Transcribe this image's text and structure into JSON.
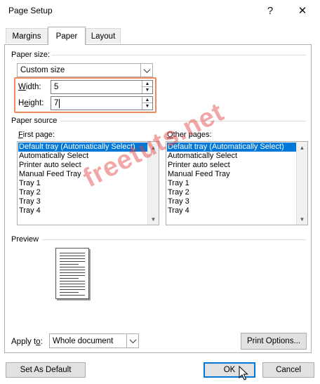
{
  "window": {
    "title": "Page Setup",
    "help_label": "?",
    "close_label": "✕"
  },
  "tabs": [
    {
      "label": "Margins"
    },
    {
      "label": "Paper"
    },
    {
      "label": "Layout"
    }
  ],
  "paper_size": {
    "group_label": "Paper size:",
    "selected": "Custom size",
    "width_label": "Width:",
    "width_value": "5",
    "height_label": "Height:",
    "height_value": "7"
  },
  "paper_source": {
    "group_label": "Paper source",
    "first_page_label": "First page:",
    "other_pages_label": "Other pages:",
    "first_page_items": [
      "Default tray (Automatically Select)",
      "Automatically Select",
      "Printer auto select",
      "Manual Feed Tray",
      "Tray 1",
      "Tray 2",
      "Tray 3",
      "Tray 4"
    ],
    "other_pages_items": [
      "Default tray (Automatically Select)",
      "Automatically Select",
      "Printer auto select",
      "Manual Feed Tray",
      "Tray 1",
      "Tray 2",
      "Tray 3",
      "Tray 4"
    ]
  },
  "preview": {
    "group_label": "Preview"
  },
  "apply_to": {
    "label": "Apply to:",
    "value": "Whole document"
  },
  "buttons": {
    "print_options": "Print Options...",
    "set_as_default": "Set As Default",
    "ok": "OK",
    "cancel": "Cancel"
  },
  "watermark": "freetuts.net",
  "colors": {
    "selection": "#0078d7",
    "highlight_box": "#ee8a5d",
    "watermark": "#e23c3c"
  }
}
